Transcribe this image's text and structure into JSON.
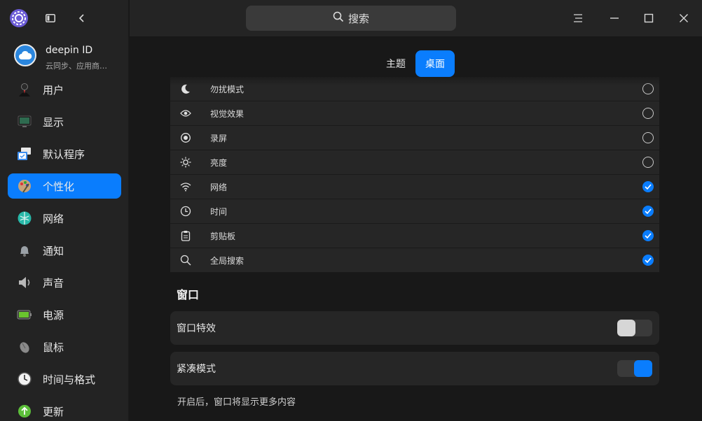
{
  "sidebar": {
    "account": {
      "name": "deepin ID",
      "subtitle": "云同步、应用商…"
    },
    "items": [
      {
        "label": "用户",
        "icon": "user-icon"
      },
      {
        "label": "显示",
        "icon": "display-icon"
      },
      {
        "label": "默认程序",
        "icon": "default-apps-icon"
      },
      {
        "label": "个性化",
        "icon": "personalization-icon",
        "active": true
      },
      {
        "label": "网络",
        "icon": "network-icon"
      },
      {
        "label": "通知",
        "icon": "bell-icon"
      },
      {
        "label": "声音",
        "icon": "speaker-icon"
      },
      {
        "label": "电源",
        "icon": "battery-icon"
      },
      {
        "label": "鼠标",
        "icon": "mouse-icon"
      },
      {
        "label": "时间与格式",
        "icon": "clock-icon"
      },
      {
        "label": "更新",
        "icon": "update-icon"
      }
    ]
  },
  "titlebar": {
    "search_label": "搜索"
  },
  "tabs": [
    {
      "label": "主题",
      "active": false
    },
    {
      "label": "桌面",
      "active": true
    }
  ],
  "plugins": [
    {
      "label": "勿扰模式",
      "icon": "moon-icon",
      "checked": false
    },
    {
      "label": "视觉效果",
      "icon": "eye-icon",
      "checked": false
    },
    {
      "label": "录屏",
      "icon": "record-icon",
      "checked": false
    },
    {
      "label": "亮度",
      "icon": "brightness-icon",
      "checked": false
    },
    {
      "label": "网络",
      "icon": "wifi-icon",
      "checked": true
    },
    {
      "label": "时间",
      "icon": "clock-icon",
      "checked": true
    },
    {
      "label": "剪贴板",
      "icon": "clipboard-icon",
      "checked": true
    },
    {
      "label": "全局搜索",
      "icon": "search-icon",
      "checked": true
    }
  ],
  "window_section": {
    "title": "窗口",
    "effects": {
      "label": "窗口特效",
      "on": false
    },
    "compact": {
      "label": "紧凑模式",
      "on": true
    },
    "hint": "开启后，窗口将显示更多内容"
  },
  "colors": {
    "accent": "#0a7dfd",
    "panel": "#262626",
    "background": "#181818"
  }
}
